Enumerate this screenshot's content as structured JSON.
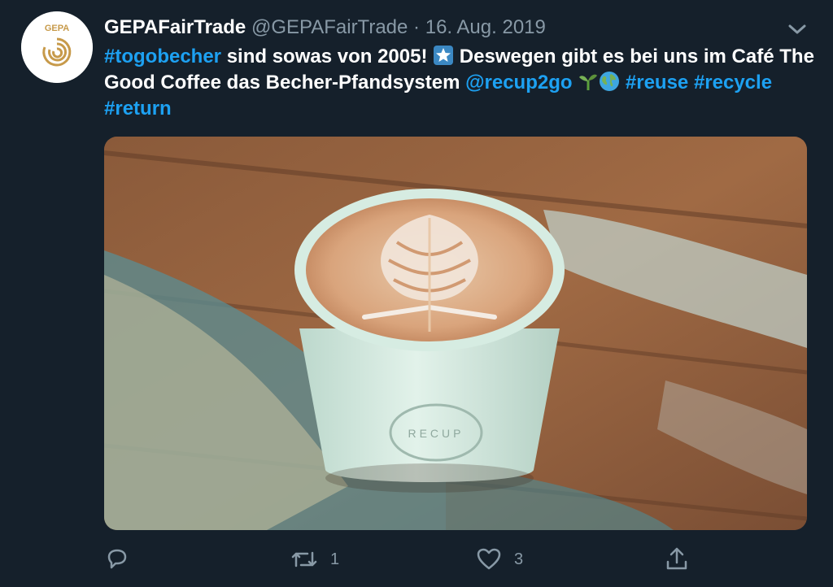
{
  "tweet": {
    "author": {
      "display_name": "GEPAFairTrade",
      "handle": "@GEPAFairTrade",
      "separator": "·",
      "date": "16. Aug. 2019",
      "logo_text": "GEPA"
    },
    "text": {
      "hashtag_togobecher": "#togobecher",
      "part1": " sind sowas von 2005! ",
      "part2": " Deswegen gibt es bei uns im Café The Good Coffee das Becher-Pfandsystem ",
      "mention_recup": "@recup2go",
      "hashtag_reuse": "#reuse",
      "hashtag_recycle": "#recycle",
      "hashtag_return": "#return"
    },
    "media": {
      "cup_brand": "RECUP"
    },
    "actions": {
      "retweet_count": "1",
      "like_count": "3"
    },
    "icons": {
      "avatar": "gepa-logo-icon",
      "caret": "chevron-down-icon",
      "star": "star-emoji-icon",
      "seedling": "seedling-emoji-icon",
      "globe": "globe-emoji-icon",
      "reply": "reply-icon",
      "retweet": "retweet-icon",
      "like": "heart-icon",
      "share": "share-icon"
    },
    "colors": {
      "background": "#15202b",
      "link": "#1da1f2",
      "secondary_text": "#8899a6"
    }
  }
}
